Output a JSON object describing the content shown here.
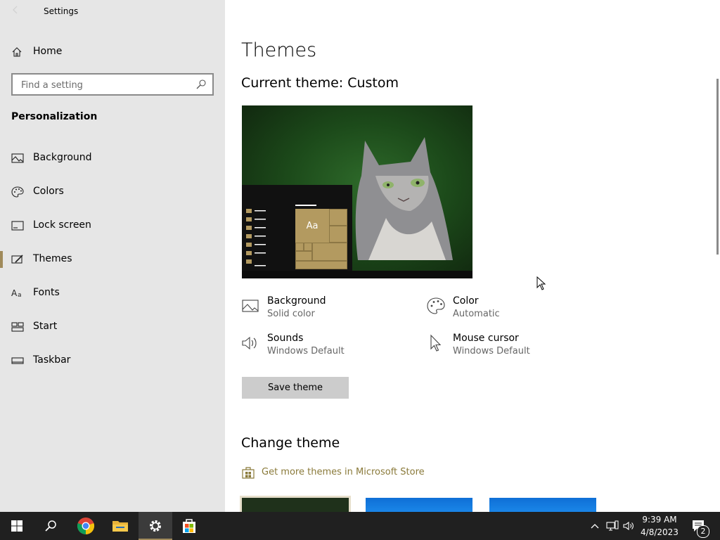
{
  "window": {
    "title": "Settings"
  },
  "sidebar": {
    "home_label": "Home",
    "search_placeholder": "Find a setting",
    "section_title": "Personalization",
    "items": [
      {
        "label": "Background",
        "icon": "picture-icon"
      },
      {
        "label": "Colors",
        "icon": "palette-icon"
      },
      {
        "label": "Lock screen",
        "icon": "lock-screen-icon"
      },
      {
        "label": "Themes",
        "icon": "themes-icon",
        "active": true
      },
      {
        "label": "Fonts",
        "icon": "fonts-icon"
      },
      {
        "label": "Start",
        "icon": "start-icon"
      },
      {
        "label": "Taskbar",
        "icon": "taskbar-icon"
      }
    ]
  },
  "main": {
    "title": "Themes",
    "current_theme": "Current theme: Custom",
    "preview_tile_text": "Aa",
    "properties": [
      {
        "name": "Background",
        "value": "Solid color",
        "icon": "picture-icon"
      },
      {
        "name": "Color",
        "value": "Automatic",
        "icon": "palette-icon"
      },
      {
        "name": "Sounds",
        "value": "Windows Default",
        "icon": "speaker-icon"
      },
      {
        "name": "Mouse cursor",
        "value": "Windows Default",
        "icon": "cursor-icon"
      }
    ],
    "save_button": "Save theme",
    "change_theme_title": "Change theme",
    "store_link": "Get more themes in Microsoft Store"
  },
  "taskbar": {
    "apps": [
      "start-icon",
      "search-icon",
      "chrome-icon",
      "file-explorer-icon",
      "settings-icon",
      "store-icon"
    ],
    "active_app": "settings-icon",
    "time": "9:39 AM",
    "date": "4/8/2023",
    "notification_count": "2"
  },
  "colors": {
    "accent": "#a08a5a",
    "sidebar_bg": "#e6e6e6",
    "taskbar_bg": "#202020",
    "link": "#8a7a3a"
  }
}
